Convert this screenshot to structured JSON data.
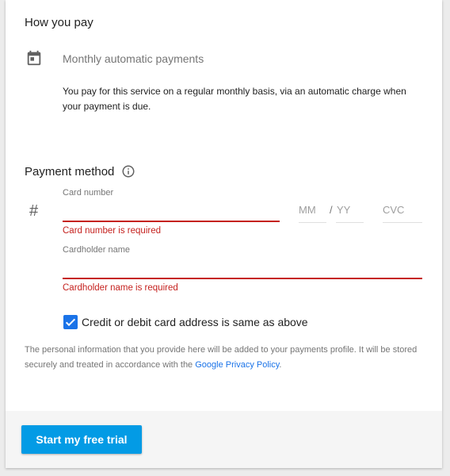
{
  "how_you_pay": {
    "title": "How you pay",
    "icon": "calendar-icon",
    "payment_type": "Monthly automatic payments",
    "description": "You pay for this service on a regular monthly basis, via an automatic charge when your payment is due."
  },
  "payment_method": {
    "title": "Payment method",
    "info_icon": "info-icon",
    "card_icon": "#",
    "card_number_label": "Card number",
    "card_number_value": "",
    "card_number_error": "Card number is required",
    "mm_placeholder": "MM",
    "slash": "/",
    "yy_placeholder": "YY",
    "cvc_placeholder": "CVC",
    "cardholder_label": "Cardholder name",
    "cardholder_value": "",
    "cardholder_error": "Cardholder name is required",
    "same_address_checked": true,
    "same_address_label": "Credit or debit card address is same as above"
  },
  "privacy": {
    "text": "The personal information that you provide here will be added to your payments profile. It will be stored securely and treated in accordance with the",
    "link": "Google Privacy Policy",
    "end": "."
  },
  "footer": {
    "button_label": "Start my free trial"
  },
  "colors": {
    "error": "#c5221f",
    "accent": "#1a73e8",
    "button": "#039be5"
  }
}
